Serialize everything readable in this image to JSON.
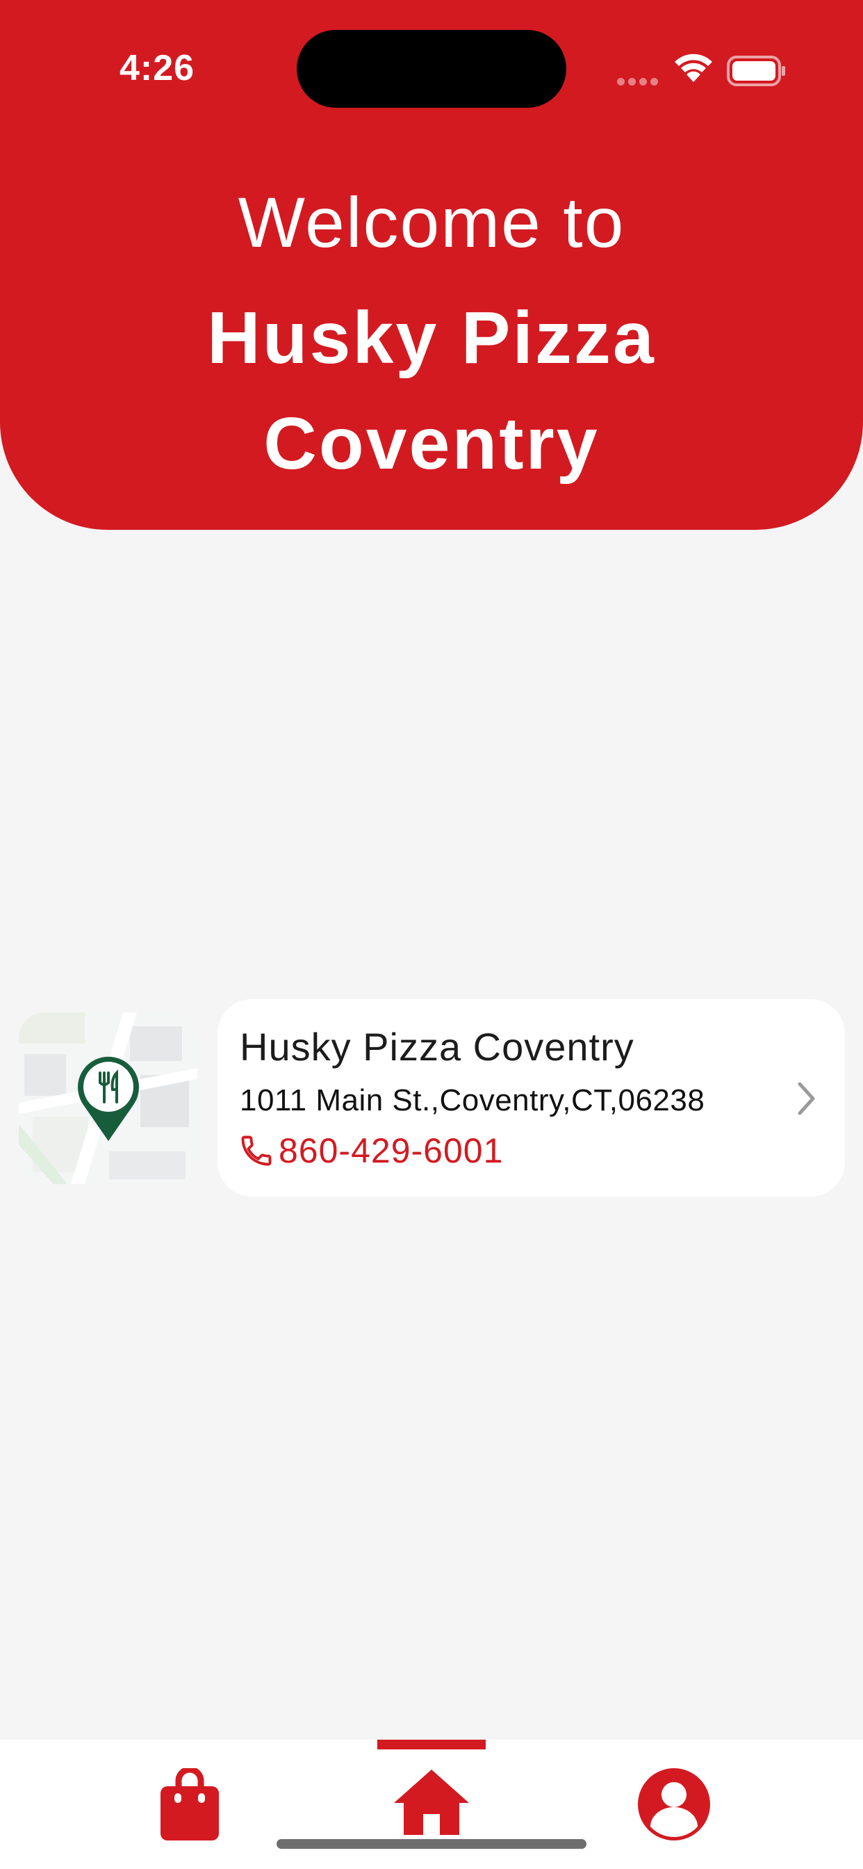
{
  "status_bar": {
    "time": "4:26"
  },
  "header": {
    "welcome": "Welcome to",
    "title_line1": "Husky Pizza",
    "title_line2": "Coventry"
  },
  "store": {
    "name": "Husky Pizza Coventry",
    "address": "1011 Main St.,Coventry,CT,06238",
    "phone": "860-429-6001"
  },
  "bottom_nav": {
    "items": [
      {
        "icon": "shopping-bag-icon",
        "active": false
      },
      {
        "icon": "home-icon",
        "active": true
      },
      {
        "icon": "profile-icon",
        "active": false
      }
    ]
  },
  "colors": {
    "brand_red": "#d31a21",
    "background": "#f5f5f5",
    "pin_green": "#175d3c"
  }
}
